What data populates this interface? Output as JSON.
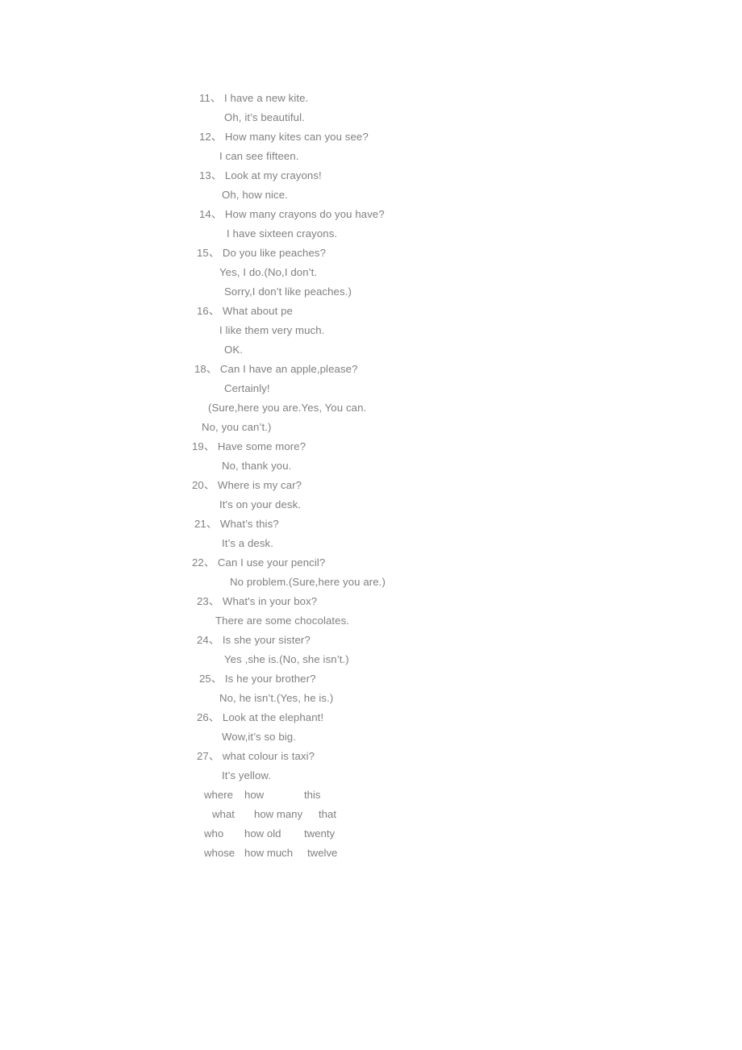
{
  "document": {
    "text_color": "#808080",
    "background_color": "#ffffff",
    "lines": [
      {
        "indent": "i3",
        "text": "11、 I have a new kite."
      },
      {
        "indent": "i11",
        "text": "Oh, it’s beautiful."
      },
      {
        "indent": "i3",
        "text": "12、 How many kites can you see?"
      },
      {
        "indent": "i9",
        "text": "I can see fifteen."
      },
      {
        "indent": "i3",
        "text": "13、 Look at my crayons!"
      },
      {
        "indent": "i10",
        "text": "Oh, how nice."
      },
      {
        "indent": "i3",
        "text": "14、 How many crayons do you have?"
      },
      {
        "indent": "i12",
        "text": "I have sixteen crayons."
      },
      {
        "indent": "i2",
        "text": "15、 Do you like peaches?"
      },
      {
        "indent": "i9",
        "text": "Yes, I do.(No,I don’t."
      },
      {
        "indent": "i11",
        "text": "Sorry,I don’t like peaches.)"
      },
      {
        "indent": "i2",
        "text": "16、 What about pe"
      },
      {
        "indent": "i9",
        "text": "I like them very much."
      },
      {
        "indent": "i11",
        "text": "OK."
      },
      {
        "indent": "i1",
        "text": "18、 Can I have an apple,please?"
      },
      {
        "indent": "i11",
        "text": "Certainly!"
      },
      {
        "indent": "i6",
        "text": "(Sure,here you are.Yes, You can."
      },
      {
        "indent": "i4",
        "text": "No, you can’t.)"
      },
      {
        "indent": "i0",
        "text": "19、 Have some more?"
      },
      {
        "indent": "i10",
        "text": "No, thank you."
      },
      {
        "indent": "i0",
        "text": "20、 Where is my car?"
      },
      {
        "indent": "i9",
        "text": "It's on your desk."
      },
      {
        "indent": "i1",
        "text": "21、 What’s this?"
      },
      {
        "indent": "i10",
        "text": "It’s a desk."
      },
      {
        "indent": "i0",
        "text": "22、 Can I use your pencil?"
      },
      {
        "indent": "i13",
        "text": "No problem.(Sure,here you are.)"
      },
      {
        "indent": "i2",
        "text": "23、 What's in your box?"
      },
      {
        "indent": "i8",
        "text": "There are some chocolates."
      },
      {
        "indent": "i2",
        "text": "24、 Is she your sister?"
      },
      {
        "indent": "i11",
        "text": "Yes ,she is.(No, she isn’t.)"
      },
      {
        "indent": "i3",
        "text": "25、 Is he your brother?"
      },
      {
        "indent": "i9",
        "text": "No, he isn’t.(Yes, he is.)"
      },
      {
        "indent": "i2",
        "text": "26、 Look at the elephant!"
      },
      {
        "indent": "i10",
        "text": "Wow,it’s so big."
      },
      {
        "indent": "i2",
        "text": "27、 what colour is taxi?"
      },
      {
        "indent": "i10",
        "text": "It’s yellow."
      }
    ],
    "word_table": {
      "rows": [
        [
          "where",
          "how",
          "this"
        ],
        [
          "what",
          "how many",
          "that"
        ],
        [
          "who",
          "how old",
          "twenty"
        ],
        [
          "whose",
          "how much",
          "twelve"
        ]
      ]
    }
  }
}
